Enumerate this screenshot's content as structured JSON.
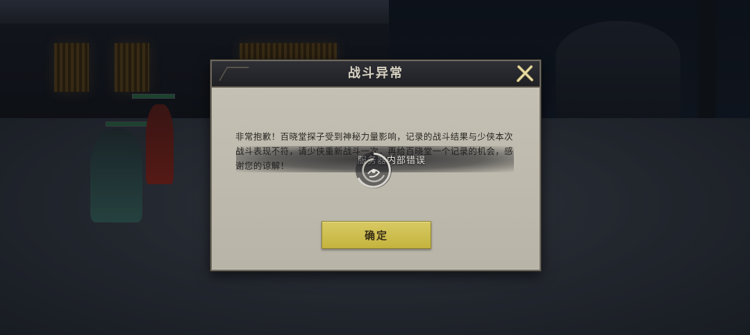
{
  "dialog": {
    "title": "战斗异常",
    "message": "非常抱歉！百晓堂探子受到神秘力量影响，记录的战斗结果与少侠本次战斗表现不符，请少侠重新战斗一次，再给百晓堂一个记录的机会，感谢您的谅解！",
    "confirm_label": "确定"
  },
  "loading": {
    "text": "服务器内部错误"
  },
  "icons": {
    "close": "close-x-icon",
    "spinner": "loading-swirl-icon"
  },
  "colors": {
    "confirm_button": "#d1c250",
    "dialog_panel": "#bdb9ad",
    "header_bar": "#26272c"
  }
}
